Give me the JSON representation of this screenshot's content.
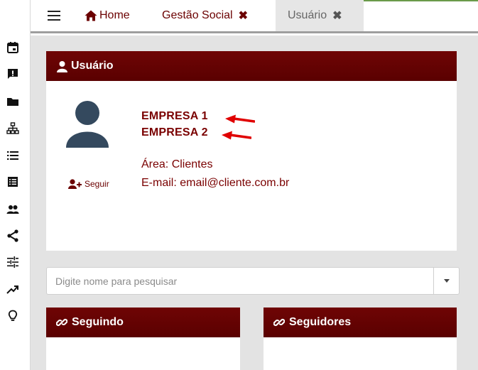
{
  "sidebar": {
    "icons": [
      "calendar-icon",
      "feedback-icon",
      "folder-icon",
      "sitemap-icon",
      "list-icon",
      "table-list-icon",
      "people-icon",
      "share-icon",
      "sliders-icon",
      "trending-up-icon",
      "lightbulb-icon"
    ]
  },
  "tabs": {
    "home": "Home",
    "gestao": "Gestão Social",
    "usuario": "Usuário",
    "close": "✖"
  },
  "user_panel": {
    "title": "Usuário",
    "follow_label": "Seguir",
    "companies": [
      "EMPRESA 1",
      "EMPRESA 2"
    ],
    "area": "Área: Clientes",
    "email": "E-mail: email@cliente.com.br"
  },
  "search": {
    "placeholder": "Digite nome para pesquisar"
  },
  "following_panel": {
    "title": "Seguindo"
  },
  "followers_panel": {
    "title": "Seguidores"
  },
  "colors": {
    "brand": "#6b0000",
    "header_bg": "#6f0505",
    "content_bg": "#e3e3e3",
    "annotation_arrow": "#e00000"
  }
}
